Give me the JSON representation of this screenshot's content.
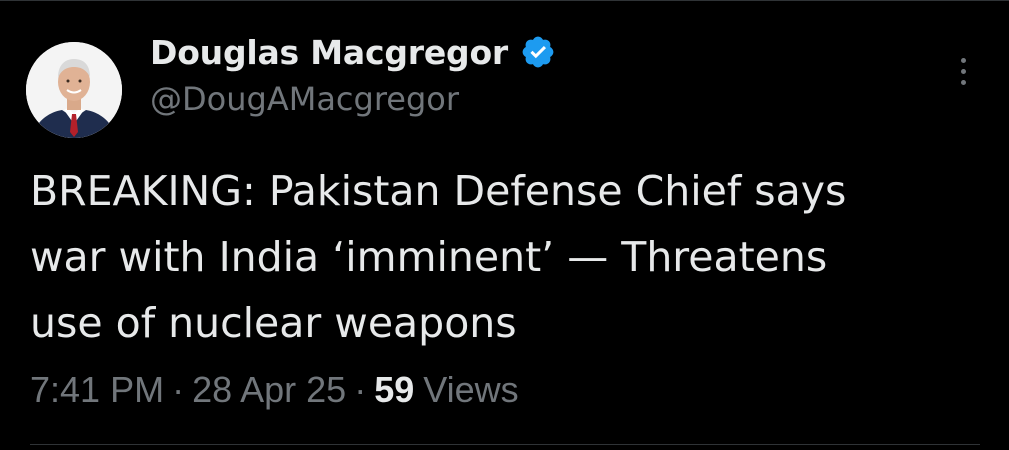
{
  "author": {
    "display_name": "Douglas Macgregor",
    "handle": "@DougAMacgregor",
    "verified": true,
    "verified_color": "#1d9bf0"
  },
  "tweet": {
    "text": "BREAKING: Pakistan Defense Chief says\nwar with India ‘imminent’ — Threatens\nuse of nuclear weapons"
  },
  "meta": {
    "time": "7:41 PM",
    "separator": "·",
    "date": "28 Apr 25",
    "views_count": "59",
    "views_label": "Views"
  },
  "icons": {
    "verified": "verified-badge-icon",
    "more": "more-options-icon"
  },
  "colors": {
    "background": "#000000",
    "primary_text": "#e7e9ea",
    "secondary_text": "#71767b",
    "divider": "#2f3336"
  }
}
